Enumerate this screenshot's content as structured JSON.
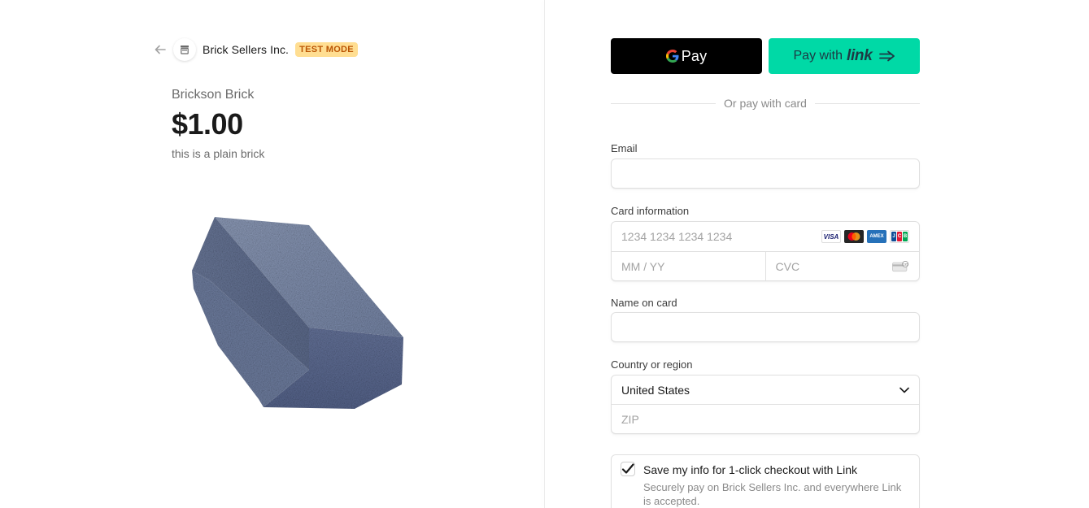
{
  "merchant": {
    "name": "Brick Sellers Inc.",
    "test_badge": "TEST MODE"
  },
  "product": {
    "name": "Brickson Brick",
    "price": "$1.00",
    "description": "this is a plain brick"
  },
  "payment_buttons": {
    "gpay_label": "Pay",
    "link_prefix": "Pay with",
    "link_word": "link"
  },
  "divider_text": "Or pay with card",
  "form": {
    "email_label": "Email",
    "email_value": "",
    "card_label": "Card information",
    "card_number_placeholder": "1234 1234 1234 1234",
    "expiry_placeholder": "MM / YY",
    "cvc_placeholder": "CVC",
    "card_brands": [
      "VISA",
      "mastercard",
      "AMEX",
      "JCB"
    ],
    "name_label": "Name on card",
    "name_value": "",
    "country_label": "Country or region",
    "country_value": "United States",
    "zip_placeholder": "ZIP"
  },
  "save_info": {
    "checked": true,
    "title": "Save my info for 1-click checkout with Link",
    "subtitle": "Securely pay on Brick Sellers Inc. and everywhere Link is accepted."
  },
  "colors": {
    "badge_bg": "#ffde92",
    "badge_text": "#bb5504",
    "link_green": "#00d9a6",
    "brick": "#6f7f9e"
  }
}
